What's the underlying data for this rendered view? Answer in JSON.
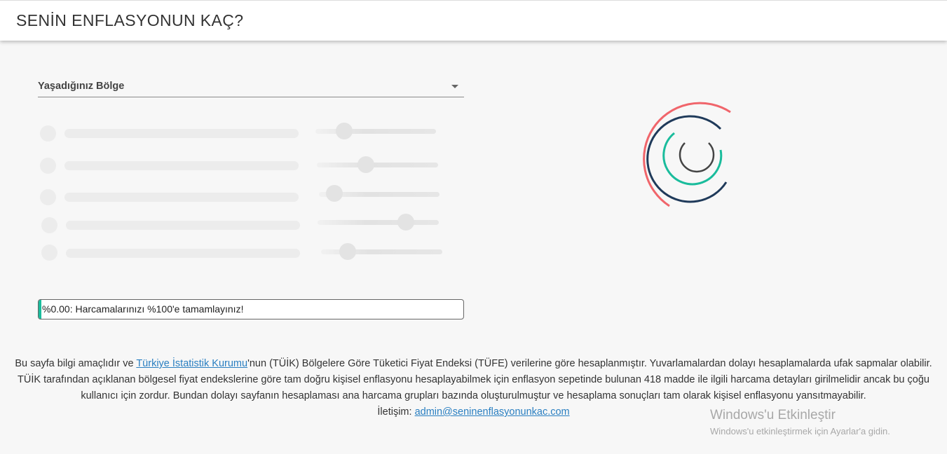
{
  "header": {
    "title": "SENİN ENFLASYONUN KAÇ?"
  },
  "region_select": {
    "label": "Yaşadığınız Bölge"
  },
  "progress": {
    "text": "%0.00: Harcamalarınızı %100'e tamamlayınız!",
    "percent": 0,
    "color": "#1abc9c"
  },
  "spinner": {
    "colors": [
      "#f0656b",
      "#1f3a5a",
      "#1abc9c",
      "#444444"
    ]
  },
  "footer": {
    "text_before_link": "Bu sayfa bilgi amaçlıdır ve ",
    "link_tuik": "Türkiye İstatistik Kurumu",
    "text_after_link": "'nun (TÜİK) Bölgelere Göre Tüketici Fiyat Endeksi (TÜFE) verilerine göre hesaplanmıştır. Yuvarlamalardan dolayı hesaplamalarda ufak sapmalar olabilir. TÜİK tarafından açıklanan bölgesel fiyat endekslerine göre tam doğru kişisel enflasyonu hesaplayabilmek için enflasyon sepetinde bulunan 418 madde ile ilgili harcama detayları girilmelidir ancak bu çoğu kullanıcı için zordur. Bundan dolayı sayfanın hesaplaması ana harcama grupları bazında oluşturulmuştur ve hesaplama sonuçları tam olarak kişisel enflasyonu yansıtmayabilir.",
    "contact_label": "İletişim:",
    "contact_email": "admin@seninenflasyonunkac.com"
  },
  "watermark": {
    "title": "Windows'u Etkinleştir",
    "subtitle": "Windows'u etkinleştirmek için Ayarlar'a gidin."
  }
}
